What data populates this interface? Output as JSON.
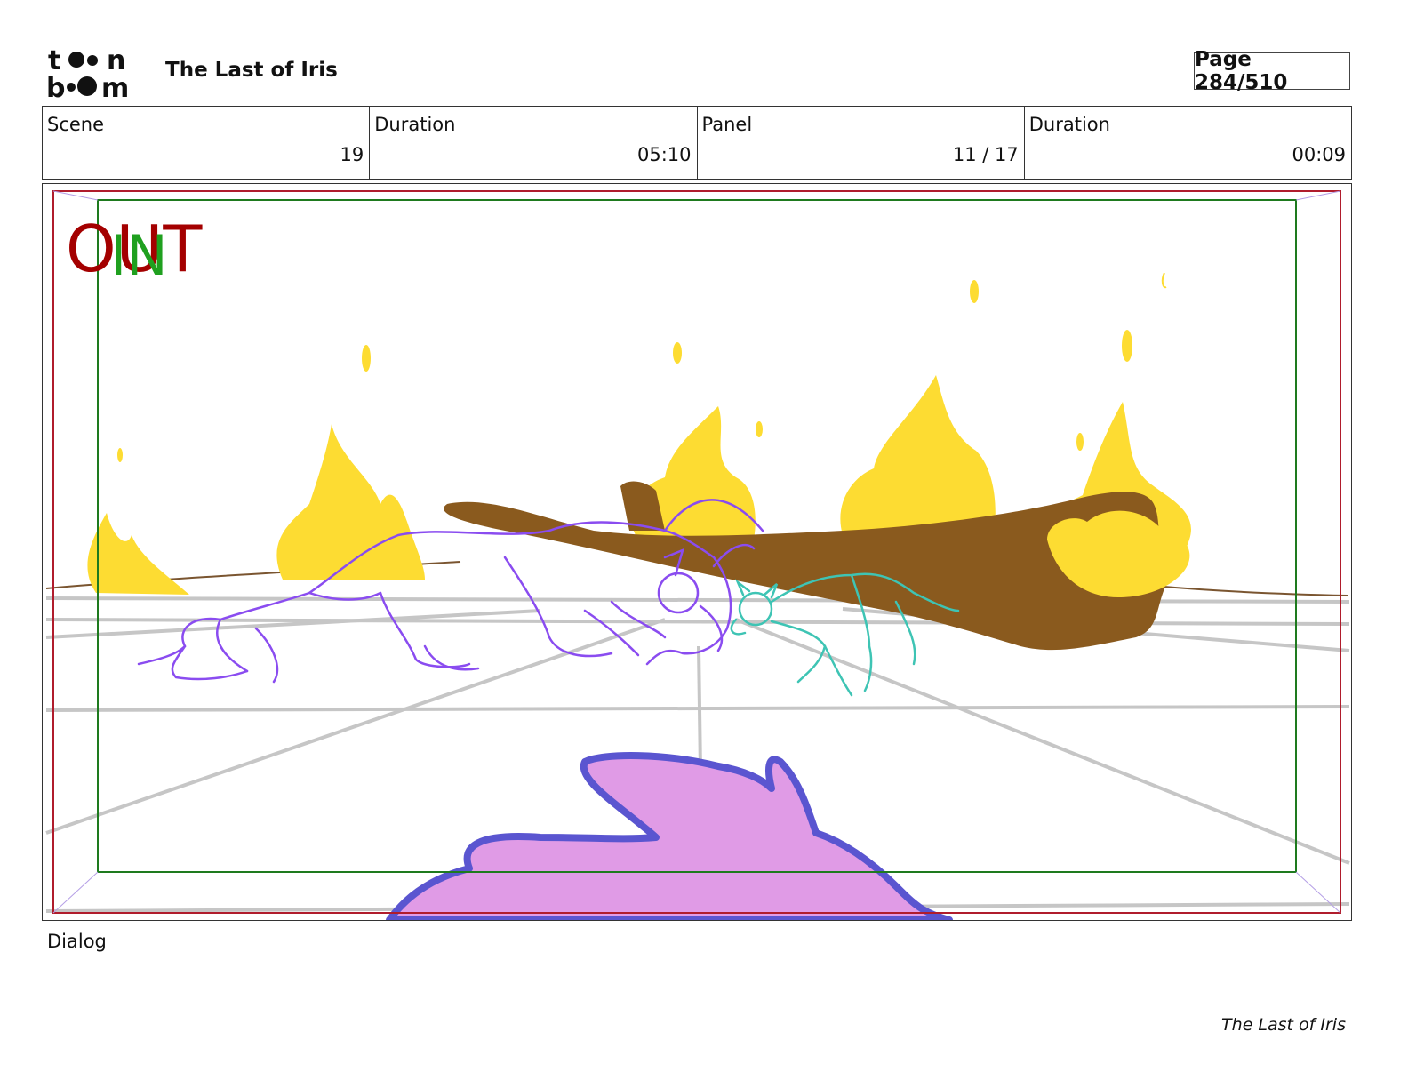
{
  "header": {
    "logo_text": "toonboom",
    "title": "The Last of Iris",
    "page": "Page 284/510"
  },
  "info": {
    "scene_label": "Scene",
    "scene_value": "19",
    "scene_duration_label": "Duration",
    "scene_duration_value": "05:10",
    "panel_label": "Panel",
    "panel_value": "11 / 17",
    "panel_duration_label": "Duration",
    "panel_duration_value": "00:09"
  },
  "frame_marks": {
    "out_text": "OUT",
    "in_text": "IN",
    "out_color": "#a40000",
    "in_color": "#1fa01f"
  },
  "colors": {
    "fire": "#fddc32",
    "log": "#8a5a1e",
    "unicorn_stroke": "#8a4cf0",
    "creature_stroke": "#3ec4b4",
    "pink_fill": "#e09be6",
    "pink_stroke": "#5a55d0",
    "safe_frame": "#1e7a1e",
    "camera_frame": "#b01c2c"
  },
  "dialog": {
    "label": "Dialog"
  },
  "footer": {
    "text": "The Last of Iris"
  }
}
